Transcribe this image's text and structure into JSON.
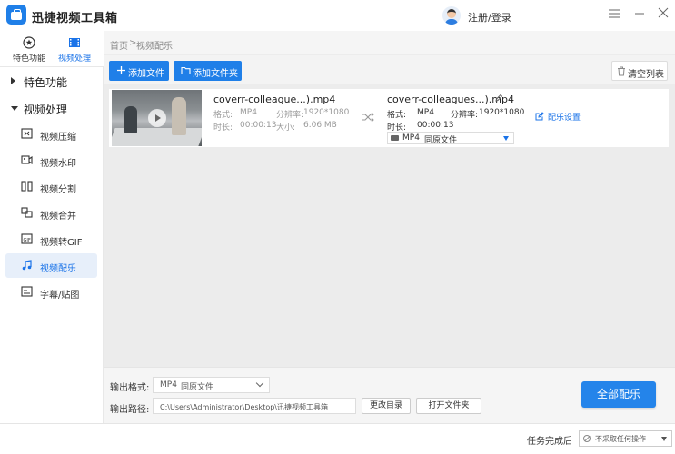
{
  "app": {
    "title": "迅捷视频工具箱",
    "login_label": "注册/登录"
  },
  "nav_tabs": [
    {
      "label": "特色功能",
      "icon": "star-icon"
    },
    {
      "label": "视频处理",
      "icon": "film-icon"
    }
  ],
  "sidebar": {
    "sections": [
      {
        "label": "特色功能",
        "expanded": false
      },
      {
        "label": "视频处理",
        "expanded": true
      }
    ],
    "items": [
      {
        "label": "视频压缩",
        "icon": "compress-icon"
      },
      {
        "label": "视频水印",
        "icon": "watermark-icon"
      },
      {
        "label": "视频分割",
        "icon": "split-icon"
      },
      {
        "label": "视频合并",
        "icon": "merge-icon"
      },
      {
        "label": "视频转GIF",
        "icon": "gif-icon"
      },
      {
        "label": "视频配乐",
        "icon": "music-icon"
      },
      {
        "label": "字幕/贴图",
        "icon": "subtitle-icon"
      }
    ],
    "active_item": "视频配乐"
  },
  "breadcrumb": {
    "home": "首页",
    "separator": ">",
    "current": "视频配乐"
  },
  "toolbar": {
    "add_file": "添加文件",
    "add_folder": "添加文件夹",
    "clear_list": "清空列表"
  },
  "file": {
    "source": {
      "name": "coverr-colleague...).mp4",
      "format_label": "格式:",
      "format": "MP4",
      "resolution_label": "分辨率:",
      "resolution": "1920*1080",
      "duration_label": "时长:",
      "duration": "00:00:13",
      "size_label": "大小:",
      "size": "6.06 MB"
    },
    "output": {
      "name": "coverr-colleagues...).mp4",
      "format_label": "格式:",
      "format": "MP4",
      "resolution_label": "分辨率:",
      "resolution": "1920*1080",
      "duration_label": "时长:",
      "duration": "00:00:13",
      "select_format": "MP4",
      "select_detail": "同原文件"
    },
    "music_settings": "配乐设置"
  },
  "bottom": {
    "format_label": "输出格式:",
    "format_value": "MP4",
    "format_detail": "同原文件",
    "path_label": "输出路径:",
    "path_value": "C:\\Users\\Administrator\\Desktop\\迅捷视频工具箱",
    "change_dir": "更改目录",
    "open_folder": "打开文件夹",
    "convert_all": "全部配乐"
  },
  "status": {
    "label": "任务完成后",
    "value": "不采取任何操作"
  },
  "colors": {
    "accent": "#1f7fe8",
    "sidebar_active_bg": "#e7effa",
    "content_bg": "#ececec"
  }
}
